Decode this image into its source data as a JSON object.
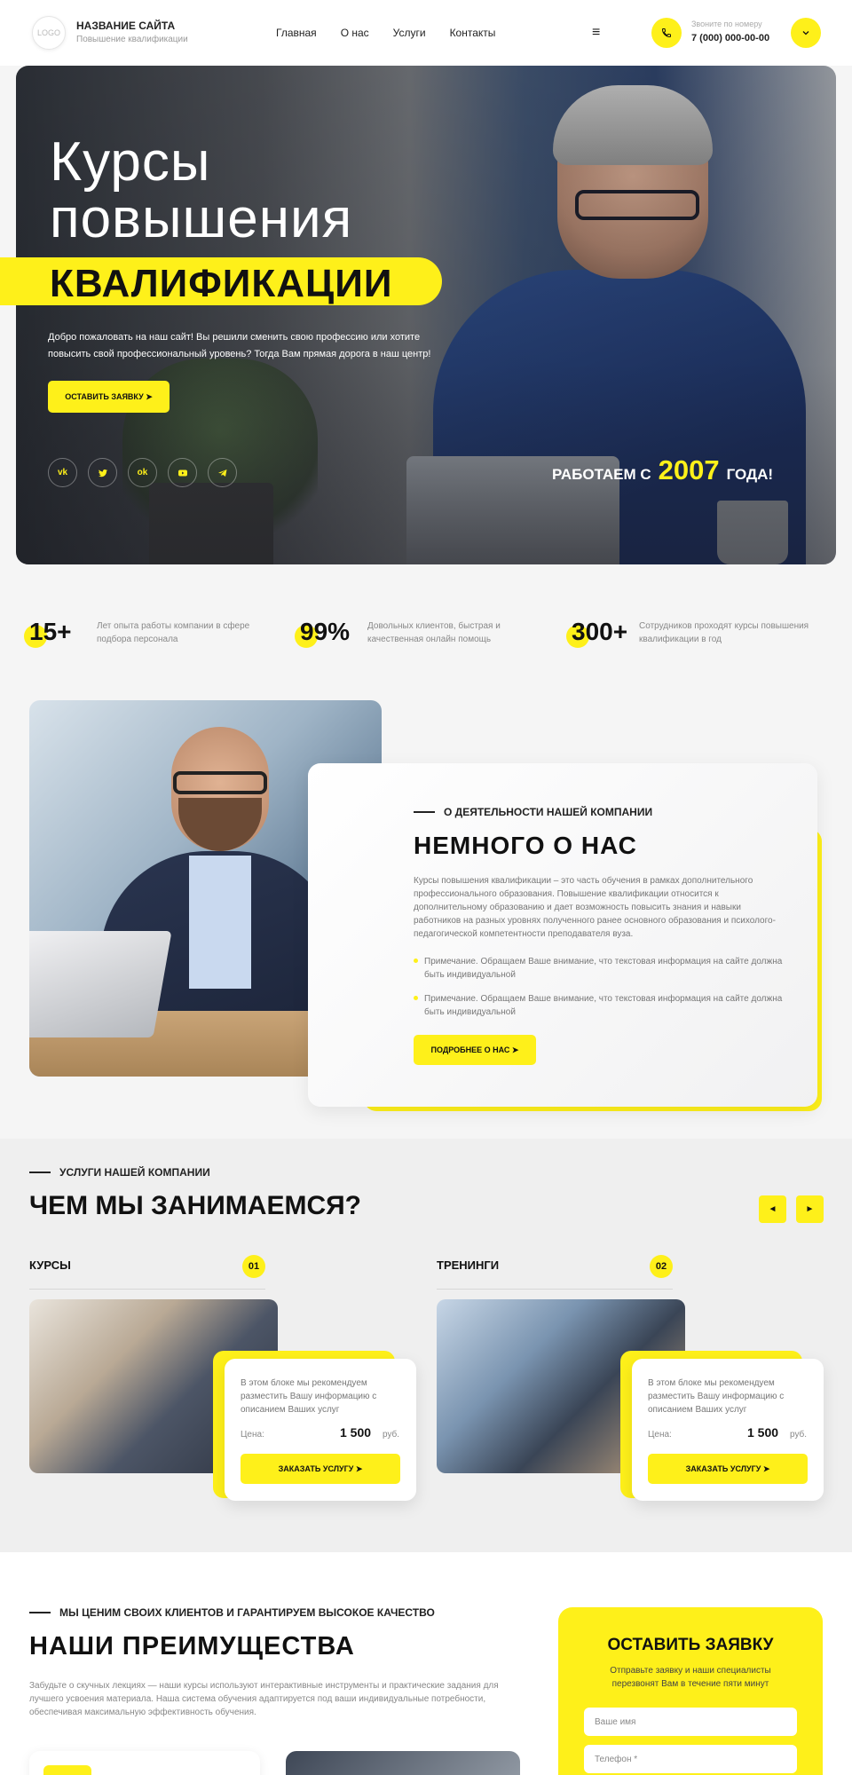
{
  "header": {
    "logo_text": "LOGO",
    "site_title": "НАЗВАНИЕ САЙТА",
    "site_subtitle": "Повышение квалификации",
    "nav": [
      "Главная",
      "О нас",
      "Услуги",
      "Контакты"
    ],
    "phone_label": "Звоните по номеру",
    "phone_number": "7 (000) 000-00-00",
    "icons": {
      "menu": "hamburger-icon",
      "phone": "phone-icon",
      "dropdown": "chevron-down-icon"
    }
  },
  "hero": {
    "title_line1": "Курсы",
    "title_line2": "повышения",
    "title_highlight": "КВАЛИФИКАЦИИ",
    "description": "Добро пожаловать на наш сайт! Вы решили сменить свою профессию или хотите повысить свой профессиональный уровень? Тогда Вам прямая дорога в наш центр!",
    "cta_label": "ОСТАВИТЬ ЗАЯВКУ ➤",
    "socials": [
      "vk-icon",
      "twitter-icon",
      "odnoklassniki-icon",
      "youtube-icon",
      "telegram-icon"
    ],
    "since_prefix": "РАБОТАЕМ С",
    "since_year": "2007",
    "since_suffix": "ГОДА!"
  },
  "stats": [
    {
      "value": "15+",
      "text": "Лет опыта работы компании в сфере подбора персонала"
    },
    {
      "value": "99%",
      "text": "Довольных клиентов, быстрая и качественная онлайн помощь"
    },
    {
      "value": "300+",
      "text": "Сотрудников проходят курсы повышения квалификации в год"
    }
  ],
  "about": {
    "kicker": "О ДЕЯТЕЛЬНОСТИ НАШЕЙ КОМПАНИИ",
    "title": "НЕМНОГО О НАС",
    "description": "Курсы повышения квалификации – это часть обучения в рамках дополнительного профессионального образования.  Повышение квалификации относится к дополнительному образованию и дает возможность повысить знания и навыки работников на разных уровнях полученного ранее основного образования и психолого-педагогической компетентности преподавателя вуза.",
    "notes": [
      "Примечание. Обращаем Ваше внимание, что текстовая информация на сайте должна быть индивидуальной",
      "Примечание. Обращаем Ваше внимание, что текстовая информация на сайте должна быть индивидуальной"
    ],
    "button_label": "ПОДРОБНЕЕ О НАС ➤"
  },
  "services": {
    "kicker": "УСЛУГИ НАШЕЙ КОМПАНИИ",
    "title": "ЧЕМ МЫ ЗАНИМАЕМСЯ?",
    "prev_label": "◄",
    "next_label": "►",
    "items": [
      {
        "title": "КУРСЫ",
        "number": "01",
        "description": "В этом блоке мы рекомендуем разместить Вашу информацию с описанием Ваших услуг",
        "price_label": "Цена:",
        "price": "1 500",
        "currency": "руб.",
        "button": "ЗАКАЗАТЬ УСЛУГУ ➤"
      },
      {
        "title": "ТРЕНИНГИ",
        "number": "02",
        "description": "В этом блоке мы рекомендуем разместить Вашу информацию с описанием Ваших услуг",
        "price_label": "Цена:",
        "price": "1 500",
        "currency": "руб.",
        "button": "ЗАКАЗАТЬ УСЛУГУ ➤"
      }
    ]
  },
  "advantages": {
    "kicker": "МЫ ЦЕНИМ СВОИХ КЛИЕНТОВ И ГАРАНТИРУЕМ ВЫСОКОЕ КАЧЕСТВО",
    "title": "НАШИ ПРЕИМУЩЕСТВА",
    "description": "Забудьте о скучных лекциях — наши курсы используют интерактивные инструменты и практические задания для лучшего усвоения материала. Наша система обучения адаптируется под ваши индивидуальные потребности, обеспечивая максимальную эффективность обучения."
  },
  "form": {
    "title": "ОСТАВИТЬ ЗАЯВКУ",
    "subtitle": "Отправьте заявку и наши специалисты перезвонят Вам в течение пяти минут",
    "name_placeholder": "Ваше имя",
    "phone_placeholder": "Телефон *"
  },
  "colors": {
    "accent": "#fef01a",
    "text": "#111111",
    "muted": "#888888",
    "background": "#f5f5f5"
  }
}
